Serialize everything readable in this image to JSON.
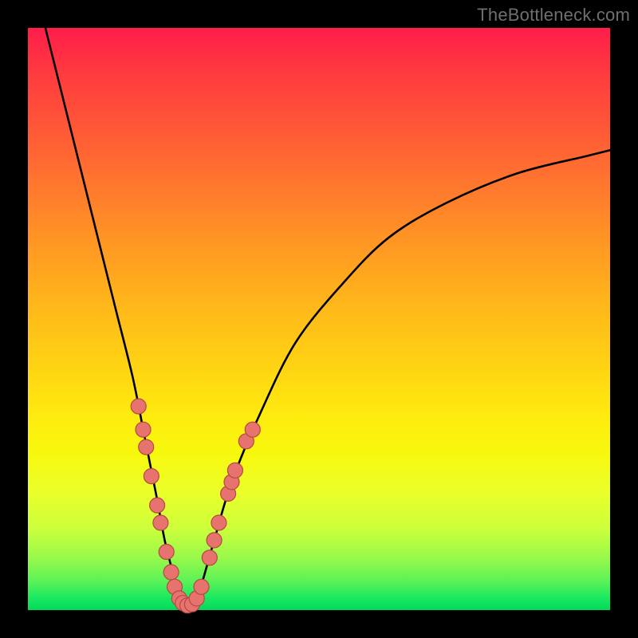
{
  "watermark": "TheBottleneck.com",
  "colors": {
    "background": "#000000",
    "curve": "#000000",
    "dot_fill": "#e6736e",
    "dot_stroke": "#b54842"
  },
  "chart_data": {
    "type": "line",
    "title": "",
    "xlabel": "",
    "ylabel": "",
    "xlim": [
      0,
      100
    ],
    "ylim": [
      0,
      100
    ],
    "grid": false,
    "legend": false,
    "annotations": [
      "TheBottleneck.com"
    ],
    "series": [
      {
        "name": "bottleneck-curve",
        "x": [
          3,
          6,
          9,
          12,
          15,
          18,
          20,
          22,
          23.5,
          25,
          26,
          27,
          28,
          29,
          30,
          32,
          35,
          40,
          46,
          54,
          62,
          72,
          84,
          96,
          100
        ],
        "y": [
          100,
          88,
          76,
          64,
          52,
          40,
          30,
          20,
          12,
          6,
          2,
          0.5,
          0.5,
          2,
          5,
          12,
          22,
          34,
          46,
          56,
          64,
          70,
          75,
          78,
          79
        ]
      }
    ],
    "markers": {
      "name": "highlight-dots",
      "note": "marker x/y in same 0–100 space as series; y measured as bottleneck %",
      "points": [
        {
          "x": 19.0,
          "y": 35
        },
        {
          "x": 19.8,
          "y": 31
        },
        {
          "x": 20.3,
          "y": 28
        },
        {
          "x": 21.2,
          "y": 23
        },
        {
          "x": 22.2,
          "y": 18
        },
        {
          "x": 22.8,
          "y": 15
        },
        {
          "x": 23.8,
          "y": 10
        },
        {
          "x": 24.6,
          "y": 6.5
        },
        {
          "x": 25.2,
          "y": 4
        },
        {
          "x": 26.0,
          "y": 2
        },
        {
          "x": 26.6,
          "y": 1.2
        },
        {
          "x": 27.4,
          "y": 0.8
        },
        {
          "x": 28.2,
          "y": 1.0
        },
        {
          "x": 29.0,
          "y": 2
        },
        {
          "x": 29.8,
          "y": 4
        },
        {
          "x": 31.2,
          "y": 9
        },
        {
          "x": 32.0,
          "y": 12
        },
        {
          "x": 32.8,
          "y": 15
        },
        {
          "x": 34.4,
          "y": 20
        },
        {
          "x": 35.0,
          "y": 22
        },
        {
          "x": 35.6,
          "y": 24
        },
        {
          "x": 37.5,
          "y": 29
        },
        {
          "x": 38.6,
          "y": 31
        }
      ]
    }
  }
}
